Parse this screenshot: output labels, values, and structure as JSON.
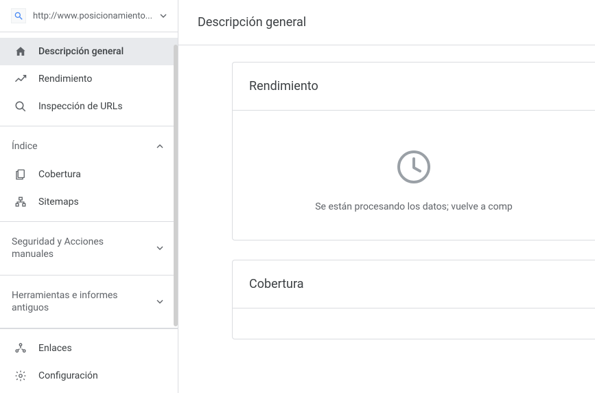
{
  "property": {
    "url": "http://www.posicionamiento..."
  },
  "sidebar": {
    "items": [
      {
        "label": "Descripción general",
        "icon": "home-icon"
      },
      {
        "label": "Rendimiento",
        "icon": "trend-icon"
      },
      {
        "label": "Inspección de URLs",
        "icon": "search-icon"
      }
    ],
    "sections": [
      {
        "label": "Índice",
        "expanded": true,
        "items": [
          {
            "label": "Cobertura",
            "icon": "pages-icon"
          },
          {
            "label": "Sitemaps",
            "icon": "sitemap-icon"
          }
        ]
      },
      {
        "label": "Seguridad y Acciones manuales",
        "expanded": false
      },
      {
        "label": "Herramientas e informes antiguos",
        "expanded": false
      }
    ],
    "footer": [
      {
        "label": "Enlaces",
        "icon": "links-icon"
      },
      {
        "label": "Configuración",
        "icon": "gear-icon"
      }
    ]
  },
  "main": {
    "title": "Descripción general",
    "cards": {
      "rendimiento": {
        "title": "Rendimiento",
        "message": "Se están procesando los datos; vuelve a comp"
      },
      "cobertura": {
        "title": "Cobertura"
      }
    }
  }
}
